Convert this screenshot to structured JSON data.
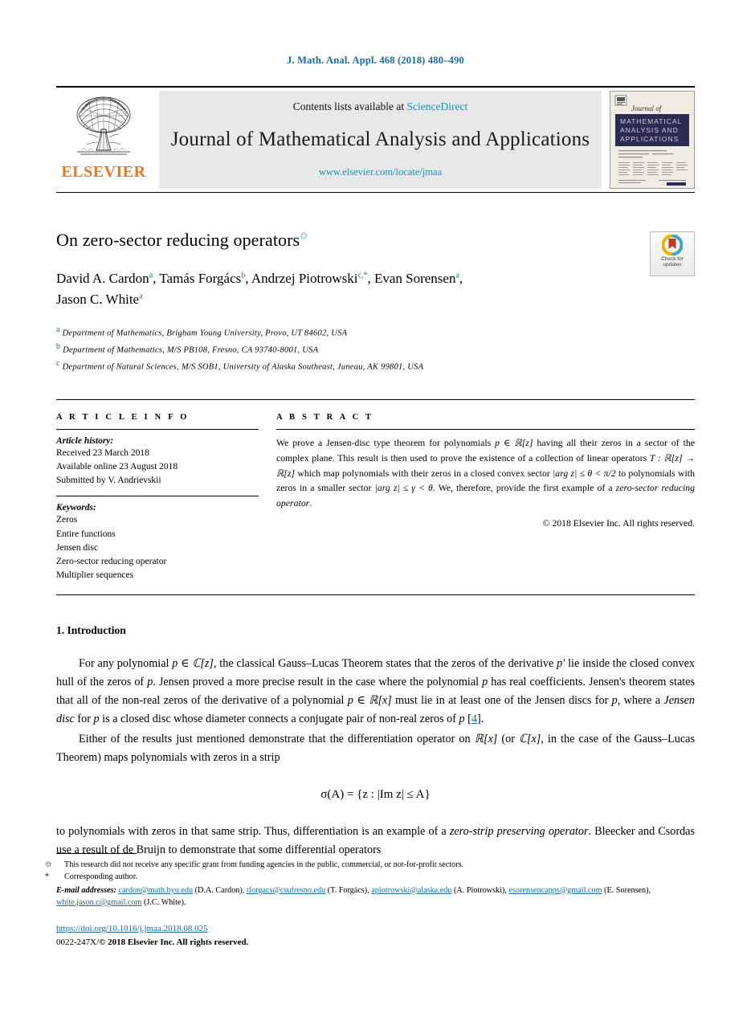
{
  "running_head": "J. Math. Anal. Appl. 468 (2018) 480–490",
  "masthead": {
    "contents_prefix": "Contents lists available at ",
    "contents_link": "ScienceDirect",
    "journal_title": "Journal of Mathematical Analysis and Applications",
    "journal_url": "www.elsevier.com/locate/jmaa",
    "publisher_wordmark": "ELSEVIER",
    "cover_journal_of": "Journal of",
    "cover_title_line1": "MATHEMATICAL",
    "cover_title_line2": "ANALYSIS AND",
    "cover_title_line3": "APPLICATIONS"
  },
  "crossmark": {
    "line1": "Check for",
    "line2": "updates"
  },
  "title": {
    "text": "On zero-sector reducing operators",
    "footnote_mark": "✩"
  },
  "authors": {
    "line1": [
      {
        "name": "David A. Cardon",
        "marks": "a",
        "sep": ", "
      },
      {
        "name": "Tamás Forgács",
        "marks": "b",
        "sep": ", "
      },
      {
        "name": "Andrzej Piotrowski",
        "marks": "c,*",
        "sep": ", "
      },
      {
        "name": "Evan Sorensen",
        "marks": "a",
        "sep": ","
      }
    ],
    "line2": [
      {
        "name": "Jason C. White",
        "marks": "a",
        "sep": ""
      }
    ]
  },
  "affiliations": [
    {
      "mark": "a",
      "text": "Department of Mathematics, Brigham Young University, Provo, UT 84602, USA"
    },
    {
      "mark": "b",
      "text": "Department of Mathematics, M/S PB108, Fresno, CA 93740-8001, USA"
    },
    {
      "mark": "c",
      "text": "Department of Natural Sciences, M/S SOB1, University of Alaska Southeast, Juneau, AK 99801, USA"
    }
  ],
  "article_info": {
    "heading": "A R T I C L E   I N F O",
    "history_label": "Article history:",
    "history": [
      "Received 23 March 2018",
      "Available online 23 August 2018",
      "Submitted by V. Andrievskii"
    ],
    "keywords_label": "Keywords:",
    "keywords": [
      "Zeros",
      "Entire functions",
      "Jensen disc",
      "Zero-sector reducing operator",
      "Multiplier sequences"
    ]
  },
  "abstract": {
    "heading": "A B S T R A C T",
    "text_parts": [
      {
        "t": "We prove a Jensen-disc type theorem for polynomials ",
        "s": "n"
      },
      {
        "t": "p ∈ ℝ[z]",
        "s": "m"
      },
      {
        "t": " having all their zeros in a sector of the complex plane. This result is then used to prove the existence of a collection of linear operators ",
        "s": "n"
      },
      {
        "t": "T : ℝ[z] → ℝ[z]",
        "s": "m"
      },
      {
        "t": " which map polynomials with their zeros in a closed convex sector ",
        "s": "n"
      },
      {
        "t": "|arg z| ≤ θ < π/2",
        "s": "m"
      },
      {
        "t": " to polynomials with zeros in a smaller sector ",
        "s": "n"
      },
      {
        "t": "|arg z| ≤ γ < θ",
        "s": "m"
      },
      {
        "t": ". We, therefore, provide the first example of a ",
        "s": "n"
      },
      {
        "t": "zero-sector reducing operator",
        "s": "i"
      },
      {
        "t": ".",
        "s": "n"
      }
    ],
    "copyright": "© 2018 Elsevier Inc. All rights reserved."
  },
  "body": {
    "section_number_title": "1.  Introduction",
    "paragraphs": [
      {
        "indent": true,
        "parts": [
          {
            "t": "For any polynomial ",
            "s": "n"
          },
          {
            "t": "p ∈ ℂ[z]",
            "s": "m"
          },
          {
            "t": ", the classical Gauss–Lucas Theorem states that the zeros of the derivative ",
            "s": "n"
          },
          {
            "t": "p′",
            "s": "m"
          },
          {
            "t": " lie inside the closed convex hull of the zeros of ",
            "s": "n"
          },
          {
            "t": "p",
            "s": "m"
          },
          {
            "t": ". Jensen proved a more precise result in the case where the polynomial ",
            "s": "n"
          },
          {
            "t": "p",
            "s": "m"
          },
          {
            "t": " has real coefficients. Jensen's theorem states that all of the non-real zeros of the derivative of a polynomial ",
            "s": "n"
          },
          {
            "t": "p ∈ ℝ[x]",
            "s": "m"
          },
          {
            "t": " must lie in at least one of the Jensen discs for ",
            "s": "n"
          },
          {
            "t": "p",
            "s": "m"
          },
          {
            "t": ", where a ",
            "s": "n"
          },
          {
            "t": "Jensen disc",
            "s": "i"
          },
          {
            "t": " for ",
            "s": "n"
          },
          {
            "t": "p",
            "s": "m"
          },
          {
            "t": " is a closed disc whose diameter connects a conjugate pair of non-real zeros of ",
            "s": "n"
          },
          {
            "t": "p",
            "s": "m"
          },
          {
            "t": " [",
            "s": "n"
          },
          {
            "t": "4",
            "s": "r"
          },
          {
            "t": "].",
            "s": "n"
          }
        ]
      },
      {
        "indent": true,
        "parts": [
          {
            "t": "Either of the results just mentioned demonstrate that the differentiation operator on ",
            "s": "n"
          },
          {
            "t": "ℝ[x]",
            "s": "m"
          },
          {
            "t": " (or ",
            "s": "n"
          },
          {
            "t": "ℂ[x]",
            "s": "m"
          },
          {
            "t": ", in the case of the Gauss–Lucas Theorem) maps polynomials with zeros in a strip",
            "s": "n"
          }
        ]
      }
    ],
    "equation": "σ(A) = {z : |Im z| ≤ A}",
    "paragraphs_after": [
      {
        "indent": false,
        "parts": [
          {
            "t": "to polynomials with zeros in that same strip. Thus, differentiation is an example of a ",
            "s": "n"
          },
          {
            "t": "zero-strip preserving operator",
            "s": "i"
          },
          {
            "t": ". Bleecker and Csordas use a result of de Bruijn to demonstrate that some differential operators",
            "s": "n"
          }
        ]
      }
    ]
  },
  "footnotes": {
    "star_mark": "✩",
    "star_text": "This research did not receive any specific grant from funding agencies in the public, commercial, or not-for-profit sectors.",
    "corresponding_mark": "*",
    "corresponding_text": "Corresponding author.",
    "emails_label": "E-mail addresses:",
    "emails": [
      {
        "address": "cardon@math.byu.edu",
        "who": "(D.A. Cardon)",
        "sep": ", "
      },
      {
        "address": "tforgacs@csufresno.edu",
        "who": "(T. Forgács)",
        "sep": ", "
      },
      {
        "address": "apiotrowski@alaska.edu",
        "who": "(A. Piotrowski)",
        "sep": ", "
      },
      {
        "address": "esorensencapps@gmail.com",
        "who": "(E. Sorensen)",
        "sep": ", "
      },
      {
        "address": "white.jason.c@gmail.com",
        "who": "(J.C. White).",
        "sep": ""
      }
    ]
  },
  "bottom": {
    "doi": "https://doi.org/10.1016/j.jmaa.2018.08.025",
    "issn_line_plain": "0022-247X/",
    "issn_line_bold": "© 2018 Elsevier Inc. All rights reserved."
  },
  "colors": {
    "link_blue": "#1b8fb5",
    "head_blue": "#1b6b9e",
    "elsevier_orange": "#e87722",
    "masthead_gray": "#e8e8e8"
  }
}
